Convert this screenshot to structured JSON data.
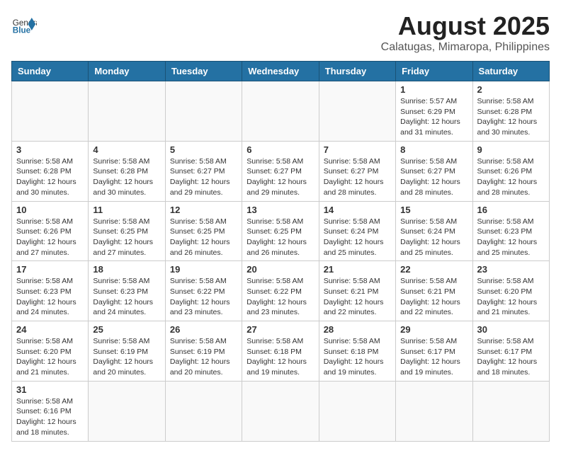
{
  "header": {
    "logo_general": "General",
    "logo_blue": "Blue",
    "title": "August 2025",
    "subtitle": "Calatugas, Mimaropa, Philippines"
  },
  "weekdays": [
    "Sunday",
    "Monday",
    "Tuesday",
    "Wednesday",
    "Thursday",
    "Friday",
    "Saturday"
  ],
  "weeks": [
    [
      {
        "day": "",
        "info": ""
      },
      {
        "day": "",
        "info": ""
      },
      {
        "day": "",
        "info": ""
      },
      {
        "day": "",
        "info": ""
      },
      {
        "day": "",
        "info": ""
      },
      {
        "day": "1",
        "info": "Sunrise: 5:57 AM\nSunset: 6:29 PM\nDaylight: 12 hours and 31 minutes."
      },
      {
        "day": "2",
        "info": "Sunrise: 5:58 AM\nSunset: 6:28 PM\nDaylight: 12 hours and 30 minutes."
      }
    ],
    [
      {
        "day": "3",
        "info": "Sunrise: 5:58 AM\nSunset: 6:28 PM\nDaylight: 12 hours and 30 minutes."
      },
      {
        "day": "4",
        "info": "Sunrise: 5:58 AM\nSunset: 6:28 PM\nDaylight: 12 hours and 30 minutes."
      },
      {
        "day": "5",
        "info": "Sunrise: 5:58 AM\nSunset: 6:27 PM\nDaylight: 12 hours and 29 minutes."
      },
      {
        "day": "6",
        "info": "Sunrise: 5:58 AM\nSunset: 6:27 PM\nDaylight: 12 hours and 29 minutes."
      },
      {
        "day": "7",
        "info": "Sunrise: 5:58 AM\nSunset: 6:27 PM\nDaylight: 12 hours and 28 minutes."
      },
      {
        "day": "8",
        "info": "Sunrise: 5:58 AM\nSunset: 6:27 PM\nDaylight: 12 hours and 28 minutes."
      },
      {
        "day": "9",
        "info": "Sunrise: 5:58 AM\nSunset: 6:26 PM\nDaylight: 12 hours and 28 minutes."
      }
    ],
    [
      {
        "day": "10",
        "info": "Sunrise: 5:58 AM\nSunset: 6:26 PM\nDaylight: 12 hours and 27 minutes."
      },
      {
        "day": "11",
        "info": "Sunrise: 5:58 AM\nSunset: 6:25 PM\nDaylight: 12 hours and 27 minutes."
      },
      {
        "day": "12",
        "info": "Sunrise: 5:58 AM\nSunset: 6:25 PM\nDaylight: 12 hours and 26 minutes."
      },
      {
        "day": "13",
        "info": "Sunrise: 5:58 AM\nSunset: 6:25 PM\nDaylight: 12 hours and 26 minutes."
      },
      {
        "day": "14",
        "info": "Sunrise: 5:58 AM\nSunset: 6:24 PM\nDaylight: 12 hours and 25 minutes."
      },
      {
        "day": "15",
        "info": "Sunrise: 5:58 AM\nSunset: 6:24 PM\nDaylight: 12 hours and 25 minutes."
      },
      {
        "day": "16",
        "info": "Sunrise: 5:58 AM\nSunset: 6:23 PM\nDaylight: 12 hours and 25 minutes."
      }
    ],
    [
      {
        "day": "17",
        "info": "Sunrise: 5:58 AM\nSunset: 6:23 PM\nDaylight: 12 hours and 24 minutes."
      },
      {
        "day": "18",
        "info": "Sunrise: 5:58 AM\nSunset: 6:23 PM\nDaylight: 12 hours and 24 minutes."
      },
      {
        "day": "19",
        "info": "Sunrise: 5:58 AM\nSunset: 6:22 PM\nDaylight: 12 hours and 23 minutes."
      },
      {
        "day": "20",
        "info": "Sunrise: 5:58 AM\nSunset: 6:22 PM\nDaylight: 12 hours and 23 minutes."
      },
      {
        "day": "21",
        "info": "Sunrise: 5:58 AM\nSunset: 6:21 PM\nDaylight: 12 hours and 22 minutes."
      },
      {
        "day": "22",
        "info": "Sunrise: 5:58 AM\nSunset: 6:21 PM\nDaylight: 12 hours and 22 minutes."
      },
      {
        "day": "23",
        "info": "Sunrise: 5:58 AM\nSunset: 6:20 PM\nDaylight: 12 hours and 21 minutes."
      }
    ],
    [
      {
        "day": "24",
        "info": "Sunrise: 5:58 AM\nSunset: 6:20 PM\nDaylight: 12 hours and 21 minutes."
      },
      {
        "day": "25",
        "info": "Sunrise: 5:58 AM\nSunset: 6:19 PM\nDaylight: 12 hours and 20 minutes."
      },
      {
        "day": "26",
        "info": "Sunrise: 5:58 AM\nSunset: 6:19 PM\nDaylight: 12 hours and 20 minutes."
      },
      {
        "day": "27",
        "info": "Sunrise: 5:58 AM\nSunset: 6:18 PM\nDaylight: 12 hours and 19 minutes."
      },
      {
        "day": "28",
        "info": "Sunrise: 5:58 AM\nSunset: 6:18 PM\nDaylight: 12 hours and 19 minutes."
      },
      {
        "day": "29",
        "info": "Sunrise: 5:58 AM\nSunset: 6:17 PM\nDaylight: 12 hours and 19 minutes."
      },
      {
        "day": "30",
        "info": "Sunrise: 5:58 AM\nSunset: 6:17 PM\nDaylight: 12 hours and 18 minutes."
      }
    ],
    [
      {
        "day": "31",
        "info": "Sunrise: 5:58 AM\nSunset: 6:16 PM\nDaylight: 12 hours and 18 minutes."
      },
      {
        "day": "",
        "info": ""
      },
      {
        "day": "",
        "info": ""
      },
      {
        "day": "",
        "info": ""
      },
      {
        "day": "",
        "info": ""
      },
      {
        "day": "",
        "info": ""
      },
      {
        "day": "",
        "info": ""
      }
    ]
  ]
}
